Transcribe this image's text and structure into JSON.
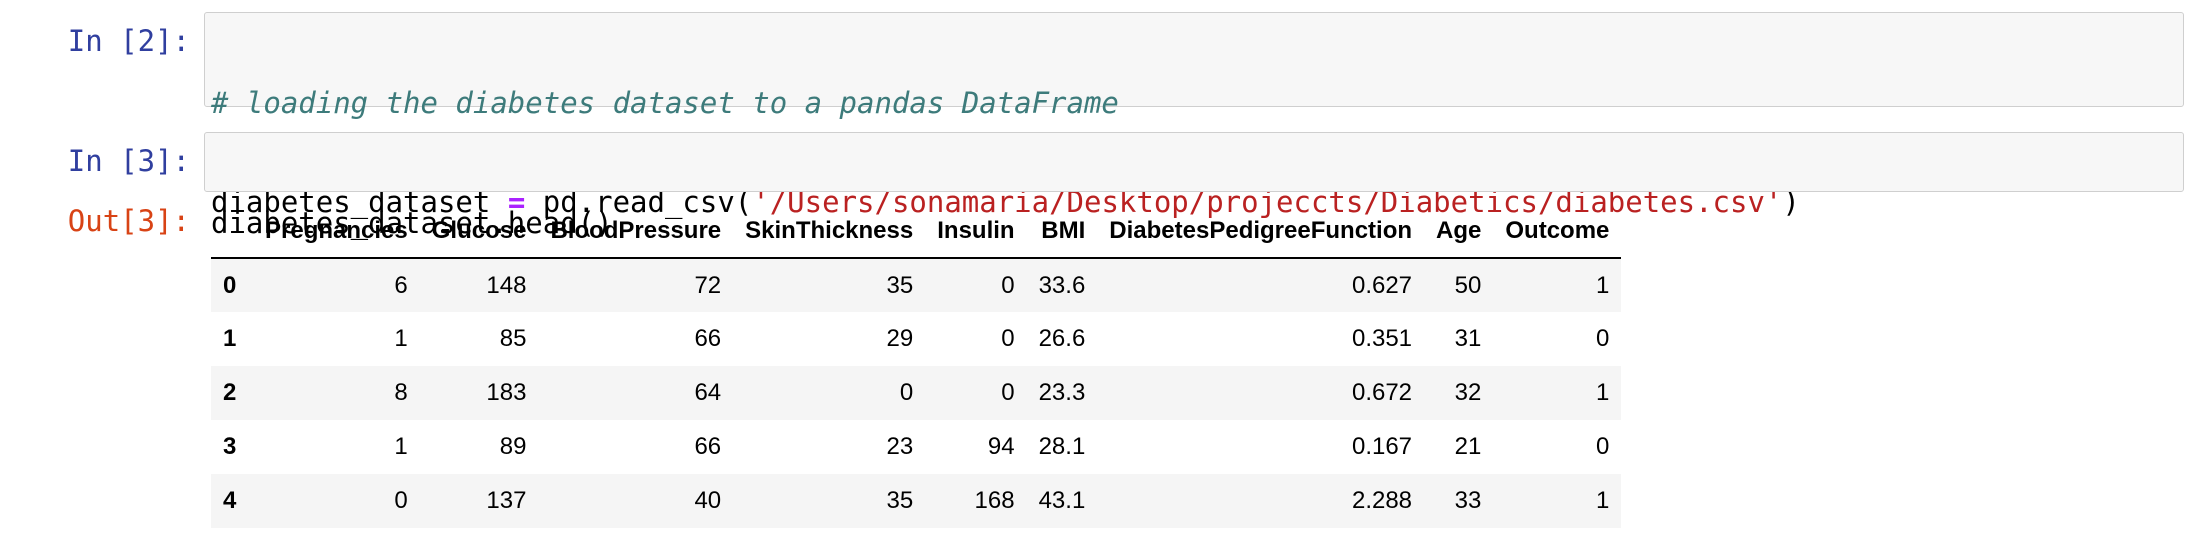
{
  "cells": [
    {
      "prompt": "In [2]:",
      "code": {
        "line1_comment": "# loading the diabetes dataset to a pandas DataFrame",
        "line2_var": "diabetes_dataset ",
        "line2_op": "=",
        "line2_call": " pd.read_csv(",
        "line2_str": "'/Users/sonamaria/Desktop/projeccts/Diabetics/diabetes.csv'",
        "line2_close": ")"
      }
    },
    {
      "prompt": "In [3]:",
      "code": {
        "line1": "diabetes_dataset.head()"
      },
      "output_prompt": "Out[3]:"
    }
  ],
  "dataframe": {
    "columns": [
      "",
      "Pregnancies",
      "Glucose",
      "BloodPressure",
      "SkinThickness",
      "Insulin",
      "BMI",
      "DiabetesPedigreeFunction",
      "Age",
      "Outcome"
    ],
    "rows": [
      [
        "0",
        "6",
        "148",
        "72",
        "35",
        "0",
        "33.6",
        "0.627",
        "50",
        "1"
      ],
      [
        "1",
        "1",
        "85",
        "66",
        "29",
        "0",
        "26.6",
        "0.351",
        "31",
        "0"
      ],
      [
        "2",
        "8",
        "183",
        "64",
        "0",
        "0",
        "23.3",
        "0.672",
        "32",
        "1"
      ],
      [
        "3",
        "1",
        "89",
        "66",
        "23",
        "94",
        "28.1",
        "0.167",
        "21",
        "0"
      ],
      [
        "4",
        "0",
        "137",
        "40",
        "35",
        "168",
        "43.1",
        "2.288",
        "33",
        "1"
      ]
    ]
  },
  "colors": {
    "in_prompt": "#303F9F",
    "out_prompt": "#D84315",
    "comment": "#3d7b7b",
    "operator": "#aa22ff",
    "string": "#ba2121",
    "input_bg": "#f7f7f7",
    "row_stripe": "#f5f5f5"
  }
}
